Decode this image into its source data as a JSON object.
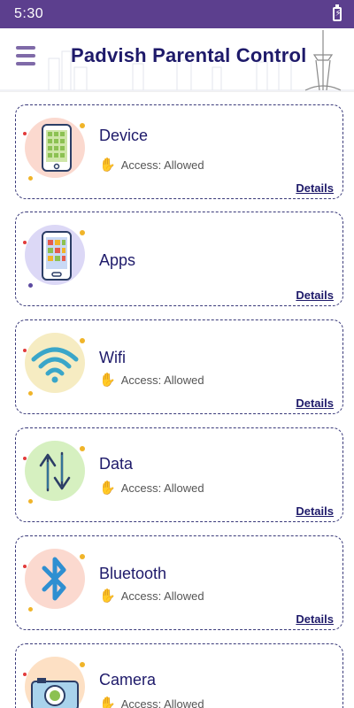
{
  "status_bar": {
    "time": "5:30"
  },
  "app_bar": {
    "title": "Padvish Parental Control"
  },
  "cards": [
    {
      "title": "Device",
      "access": "Access: Allowed",
      "details": "Details",
      "icon": "phone-grid-icon",
      "circle_color": "#fbd9cf"
    },
    {
      "title": "Apps",
      "access": "",
      "details": "Details",
      "icon": "apps-phone-icon",
      "circle_color": "#dcd8f6"
    },
    {
      "title": "Wifi",
      "access": "Access: Allowed",
      "details": "Details",
      "icon": "wifi-icon",
      "circle_color": "#f6ecc2"
    },
    {
      "title": "Data",
      "access": "Access: Allowed",
      "details": "Details",
      "icon": "data-arrows-icon",
      "circle_color": "#d6f0c0"
    },
    {
      "title": "Bluetooth",
      "access": "Access: Allowed",
      "details": "Details",
      "icon": "bluetooth-icon",
      "circle_color": "#fbd9cf"
    },
    {
      "title": "Camera",
      "access": "Access: Allowed",
      "details": "",
      "icon": "camera-icon",
      "circle_color": "#fde0c4"
    }
  ],
  "colors": {
    "status_bar": "#5c3f8e",
    "title": "#1e1a6a",
    "menu": "#7f6aa8"
  }
}
